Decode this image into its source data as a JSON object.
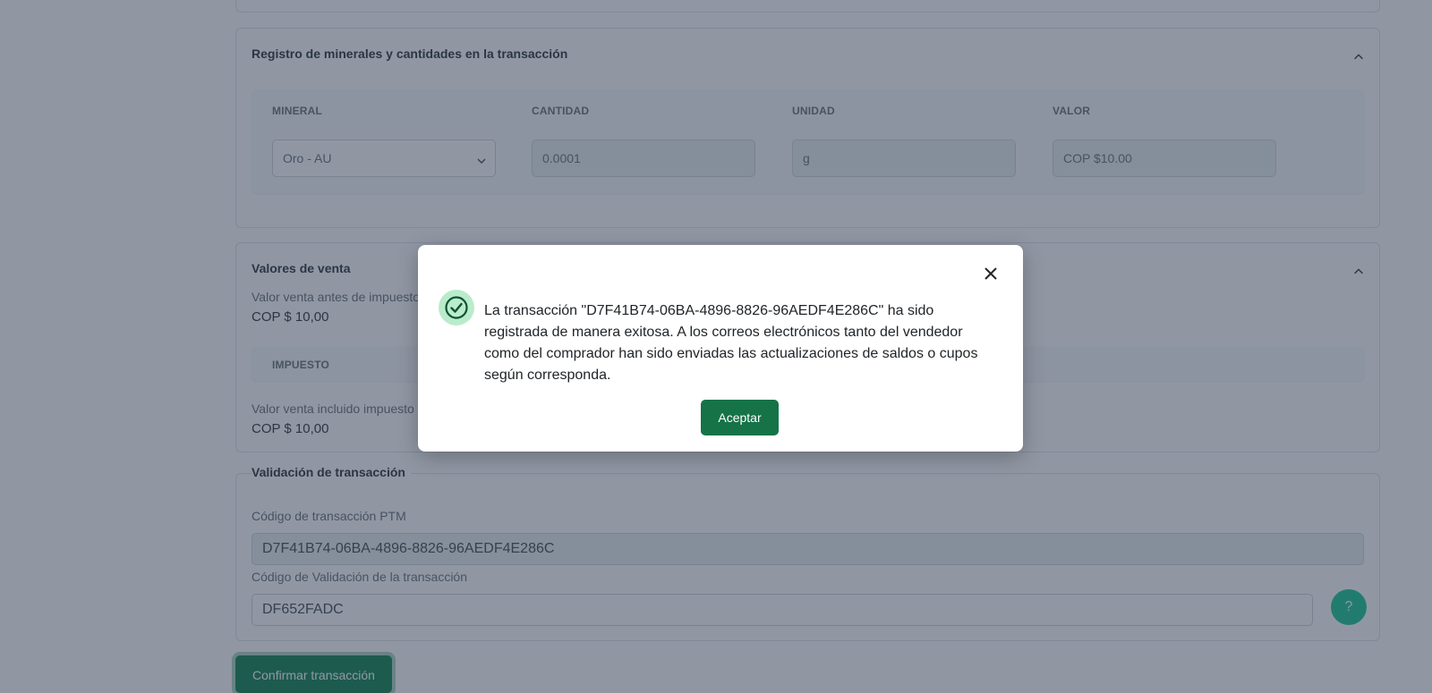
{
  "minerals_section": {
    "title": "Registro de minerales y cantidades en la transacción",
    "columns": [
      "MINERAL",
      "CANTIDAD",
      "UNIDAD",
      "VALOR"
    ],
    "row": {
      "mineral": "Oro - AU",
      "cantidad": "0.0001",
      "unidad": "g",
      "valor": "COP $10.00"
    }
  },
  "sales_section": {
    "title": "Valores de venta",
    "before_tax_label": "Valor venta antes de impuesto",
    "before_tax_value": "COP $ 10,00",
    "tax_column": "IMPUESTO",
    "after_tax_label": "Valor venta incluido impuesto",
    "after_tax_value": "COP $ 10,00"
  },
  "validation_section": {
    "title": "Validación de transacción",
    "ptm_code_label": "Código de transacción PTM",
    "ptm_code_value": "D7F41B74-06BA-4896-8826-96AEDF4E286C",
    "validation_code_label": "Código de Validación de la transacción",
    "validation_code_value": "DF652FADC"
  },
  "confirm_button": "Confirmar transacción",
  "help_button": "?",
  "modal": {
    "message": "La transacción \"D7F41B74-06BA-4896-8826-96AEDF4E286C\" ha sido registrada de manera exitosa. A los correos electrónicos tanto del vendedor como del comprador han sido enviadas las actualizaciones de saldos o cupos según corresponda.",
    "accept_label": "Aceptar"
  },
  "colors": {
    "primary_green": "#198754",
    "accept_green": "#157347",
    "success_icon_bg": "#b9eccb",
    "overlay": "rgba(33,47,72,0.5)"
  },
  "icons": [
    "chevron-up-icon",
    "chevron-down-icon",
    "close-icon",
    "check-circle-icon"
  ]
}
